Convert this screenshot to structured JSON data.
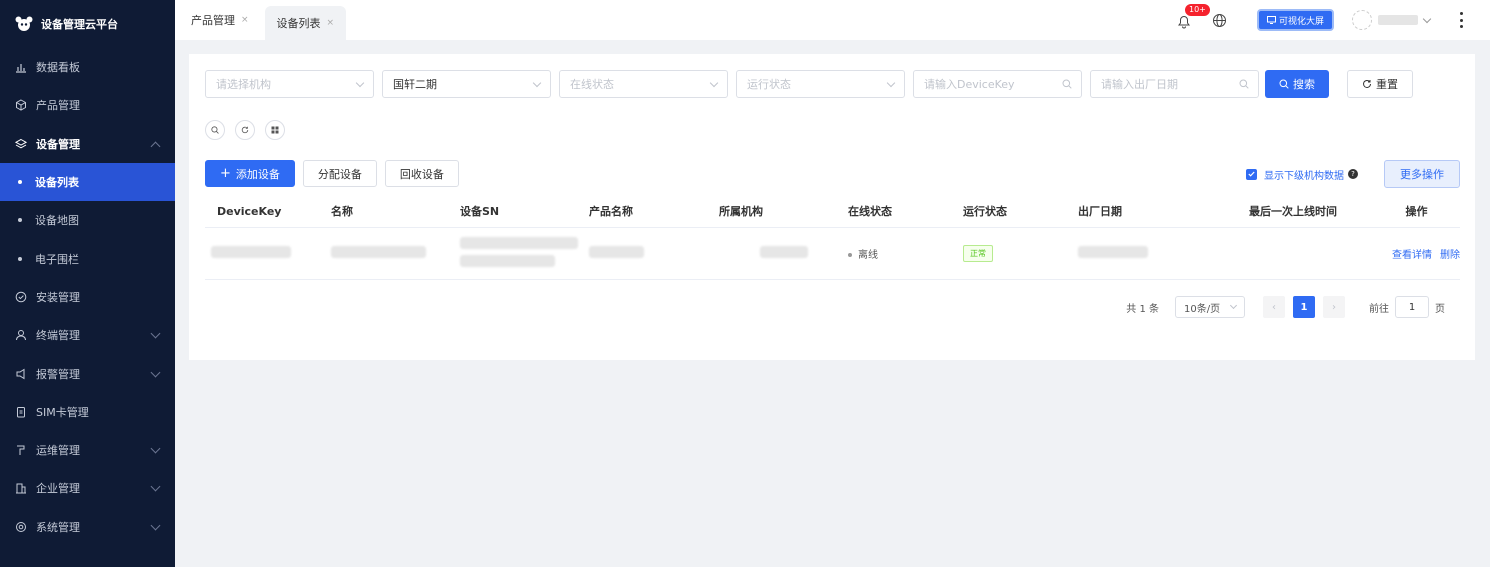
{
  "app": {
    "title": "设备管理云平台"
  },
  "sidebar": {
    "items": [
      {
        "label": "数据看板",
        "icon": "chart-icon"
      },
      {
        "label": "产品管理",
        "icon": "cube-icon"
      },
      {
        "label": "设备管理",
        "icon": "layers-icon"
      },
      {
        "label": "设备列表"
      },
      {
        "label": "设备地图"
      },
      {
        "label": "电子围栏"
      },
      {
        "label": "安装管理",
        "icon": "check-circle-icon"
      },
      {
        "label": "终端管理",
        "icon": "user-icon"
      },
      {
        "label": "报警管理",
        "icon": "alarm-icon"
      },
      {
        "label": "SIM卡管理",
        "icon": "clipboard-icon"
      },
      {
        "label": "运维管理",
        "icon": "tool-icon"
      },
      {
        "label": "企业管理",
        "icon": "building-icon"
      },
      {
        "label": "系统管理",
        "icon": "settings-icon"
      }
    ]
  },
  "tabs": [
    {
      "label": "产品管理"
    },
    {
      "label": "设备列表"
    }
  ],
  "header": {
    "notification_count": "10+",
    "visual_button": "可视化大屏"
  },
  "filters": {
    "org_placeholder": "请选择机构",
    "project_value": "国轩二期",
    "online_placeholder": "在线状态",
    "run_placeholder": "运行状态",
    "devicekey_placeholder": "请输入DeviceKey",
    "date_placeholder": "请输入出厂日期",
    "search_label": "搜索",
    "reset_label": "重置"
  },
  "actions": {
    "add_label": "添加设备",
    "assign_label": "分配设备",
    "recycle_label": "回收设备",
    "show_sub_label": "显示下级机构数据",
    "more_label": "更多操作"
  },
  "table": {
    "headers": [
      "DeviceKey",
      "名称",
      "设备SN",
      "产品名称",
      "所属机构",
      "在线状态",
      "运行状态",
      "出厂日期",
      "最后一次上线时间",
      "操作"
    ],
    "rows": [
      {
        "online": "离线",
        "run": "正常",
        "detail": "查看详情",
        "delete": "删除"
      }
    ]
  },
  "pagination": {
    "total": "共 1 条",
    "page_size": "10条/页",
    "current": "1",
    "goto_prefix": "前往",
    "goto_value": "1",
    "goto_suffix": "页"
  }
}
